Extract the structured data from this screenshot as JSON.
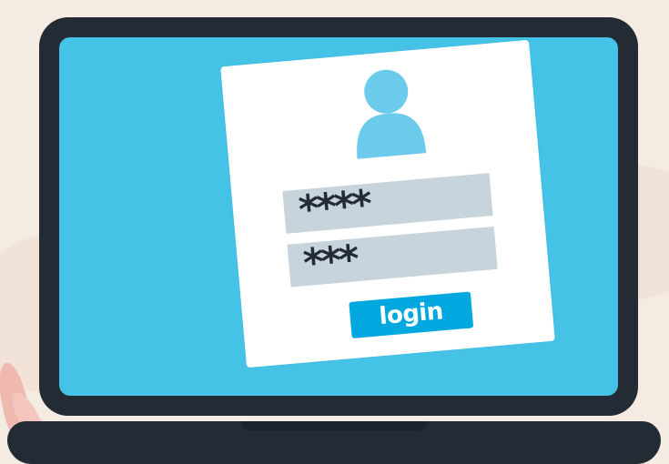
{
  "scene": {
    "colors": {
      "background": "#f4ebe2",
      "laptop_frame": "#232b35",
      "screen": "#45c3e6",
      "dialog": "#ffffff",
      "field": "#c8d4dc",
      "button": "#00a8df",
      "avatar": "#6ccaea"
    }
  },
  "login_form": {
    "avatar_icon": "user-avatar-icon",
    "username_value": "****",
    "password_value": "***",
    "button_label": "login"
  }
}
